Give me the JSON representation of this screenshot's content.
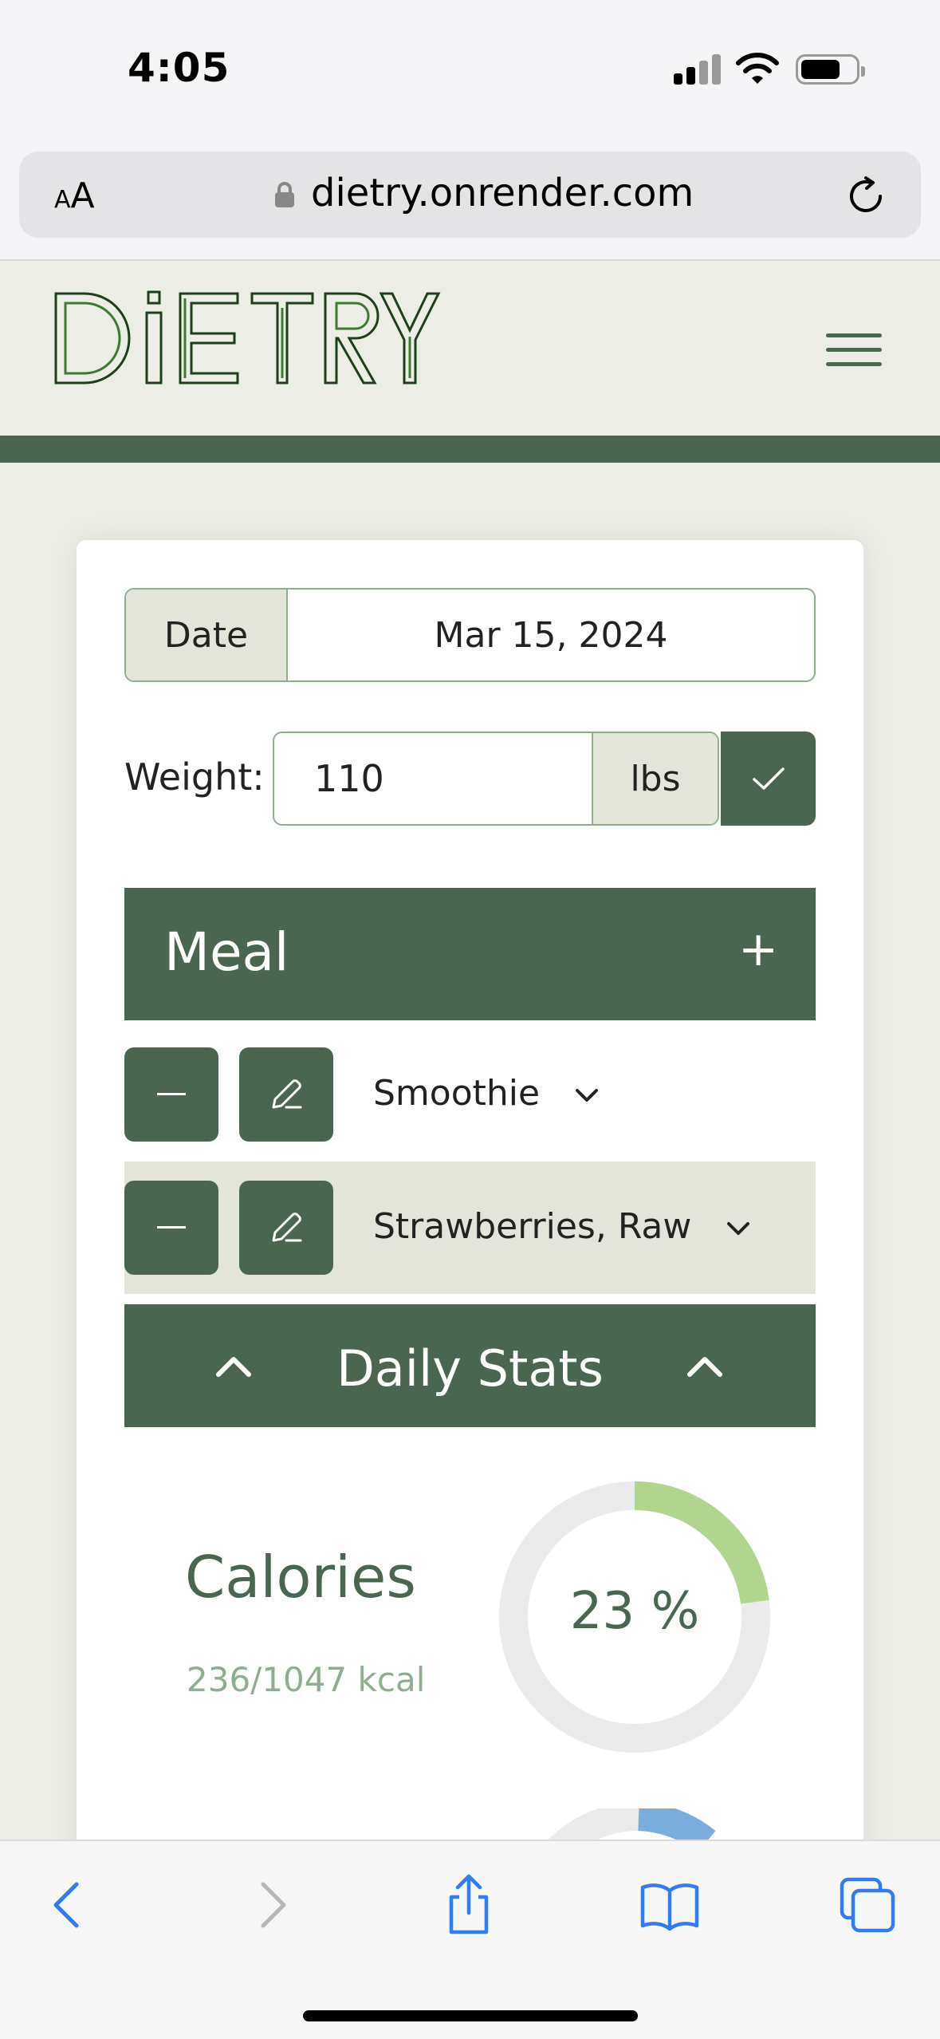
{
  "status_bar": {
    "time": "4:05"
  },
  "browser": {
    "text_size_label_small": "A",
    "text_size_label_large": "A",
    "url": "dietry.onrender.com"
  },
  "site": {
    "logo_text": "DiETRY"
  },
  "form": {
    "date_label": "Date",
    "date_value": "Mar 15, 2024",
    "weight_label": "Weight:",
    "weight_value": "110",
    "weight_unit": "lbs"
  },
  "meal": {
    "title": "Meal",
    "add_symbol": "+",
    "items": [
      {
        "label": "Smoothie"
      },
      {
        "label": "Strawberries, Raw"
      }
    ]
  },
  "daily_stats": {
    "title": "Daily Stats",
    "calories": {
      "title": "Calories",
      "summary": "236/1047 kcal",
      "percent_label": "23 %",
      "percent": 23
    }
  },
  "colors": {
    "primary": "#4b6650",
    "accent_light": "#b1d48f",
    "ring_bg": "#ebebeb",
    "second_ring": "#7aacdc",
    "ios_blue": "#2f7cf6"
  }
}
